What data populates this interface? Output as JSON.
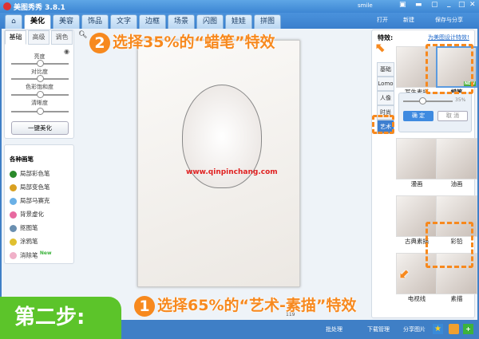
{
  "app": {
    "title": "美图秀秀 3.8.1",
    "user": "smile"
  },
  "top_actions": {
    "open": "打开",
    "new": "新建",
    "save_share": "保存与分享"
  },
  "tabs": [
    "美化",
    "美容",
    "饰品",
    "文字",
    "边框",
    "场景",
    "闪图",
    "娃娃",
    "拼图"
  ],
  "left": {
    "tabs": [
      "基础",
      "高级",
      "调色"
    ],
    "sliders": [
      {
        "label": "亮度",
        "value": 50
      },
      {
        "label": "对比度",
        "value": 50
      },
      {
        "label": "色彩饱和度",
        "value": 50
      },
      {
        "label": "清晰度",
        "value": 50
      }
    ],
    "one_click": "一键美化",
    "brush_title": "各种画笔",
    "brushes": [
      {
        "label": "局部彩色笔",
        "color": "#2a8a2a"
      },
      {
        "label": "局部变色笔",
        "color": "#d9a020"
      },
      {
        "label": "局部马赛克",
        "color": "#6ab0e6"
      },
      {
        "label": "背景虚化",
        "color": "#e86aa0"
      },
      {
        "label": "抠图笔",
        "color": "#6a8fb0"
      },
      {
        "label": "涂鸦笔",
        "color": "#e0c030"
      },
      {
        "label": "消除笔",
        "color": "#f0b0c8"
      }
    ],
    "new_badge": "New"
  },
  "canvas": {
    "watermark": "www.qinpinchang.com",
    "zoom_text": "119"
  },
  "right": {
    "title": "特效:",
    "link": "为美图设计特效!",
    "vtabs": [
      "基础",
      "Lomo",
      "人像",
      "时尚",
      "艺术"
    ],
    "top_effects": [
      {
        "label": "写生素描"
      },
      {
        "label": "蜡笔",
        "badge": "NEW"
      }
    ],
    "intensity": {
      "value": 35,
      "label": "35%"
    },
    "confirm": "确 定",
    "cancel": "取 消",
    "effects": [
      "漫画",
      "油画",
      "古典素描",
      "彩铅",
      "电视线",
      "素描"
    ]
  },
  "status": {
    "batch": "批处理",
    "download": "下载管理",
    "share": "分享图片"
  },
  "annotations": {
    "step": "第二步:",
    "step1_num": "1",
    "step1": "选择65%的“艺术-素描”特效",
    "step2_num": "2",
    "step2": "选择35%的“蜡笔”特效"
  },
  "colors": {
    "accent": "#f7891e",
    "step_badge": "#5cc42a",
    "chrome": "#3f7fc6"
  }
}
